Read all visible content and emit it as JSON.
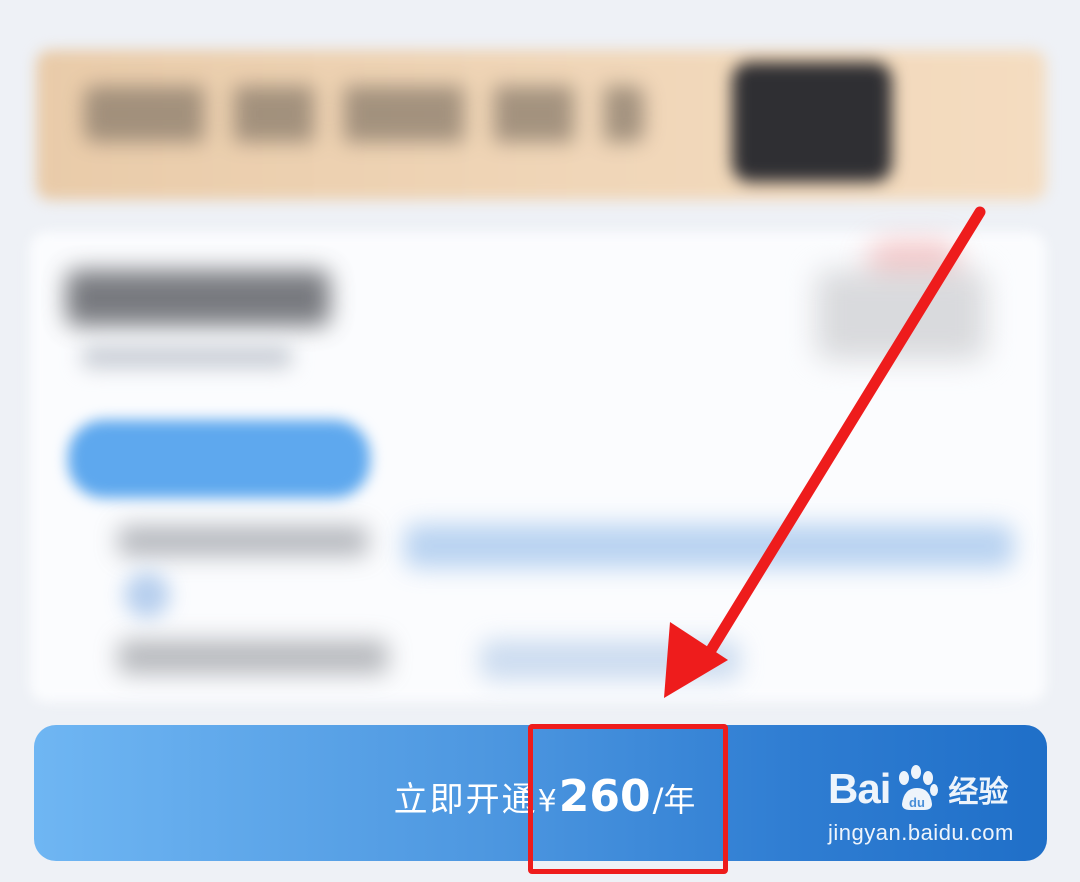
{
  "cta": {
    "prefix": "立即开通",
    "currency": "¥",
    "price": "260",
    "unit": "/年"
  },
  "watermark": {
    "logo_text_left": "Bai",
    "logo_text_right": "经验",
    "url": "jingyan.baidu.com"
  },
  "annotation": {
    "color": "#ee1c1c",
    "shapes": [
      "rectangle",
      "arrow"
    ]
  },
  "colors": {
    "cta_start": "#6fb6f3",
    "cta_end": "#1f6fc8",
    "banner": "#f0d6b8",
    "pill": "#5ea8ee"
  }
}
